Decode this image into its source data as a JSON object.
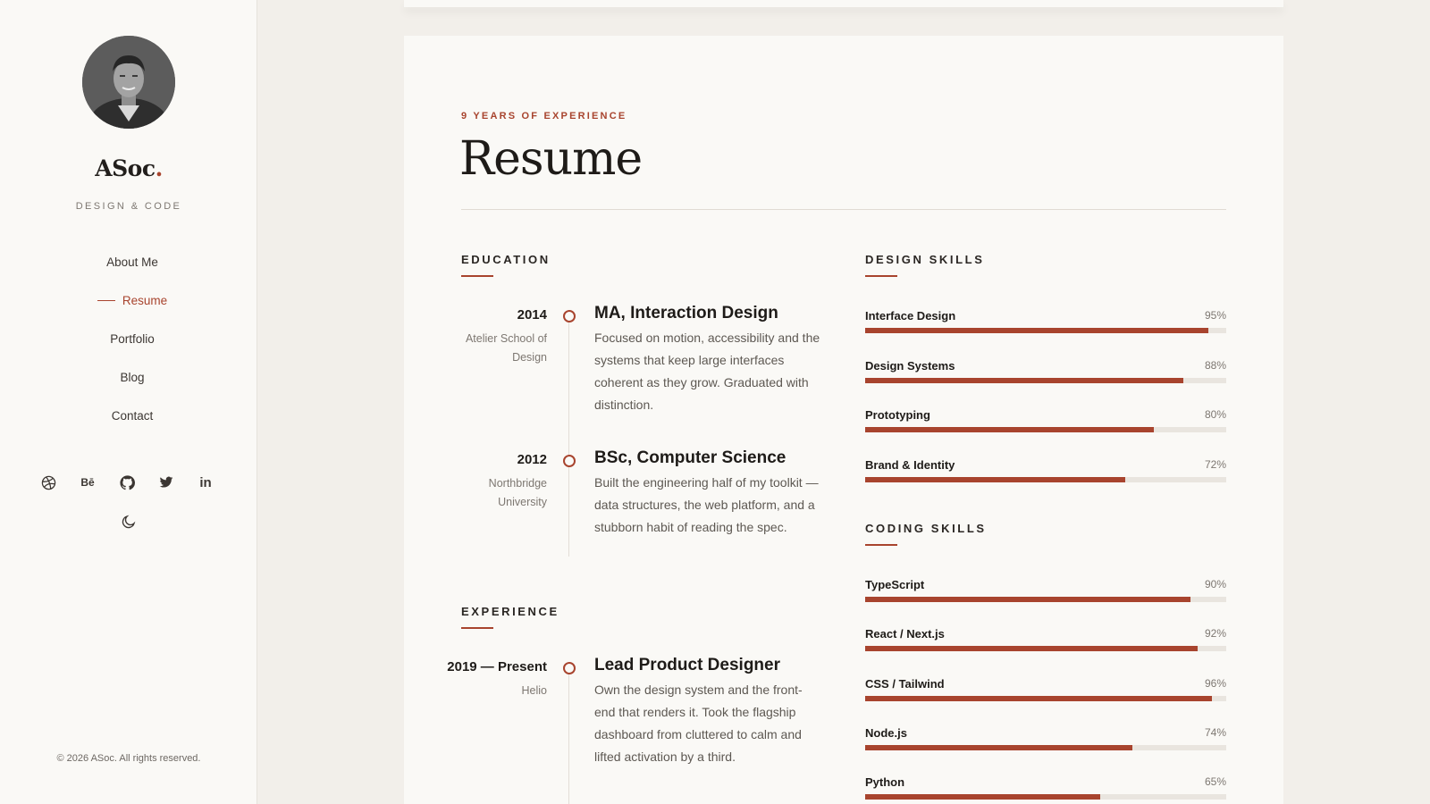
{
  "sidebar": {
    "brand_name": "ASoc",
    "brand_dot": ".",
    "tagline": "DESIGN & CODE",
    "nav": [
      {
        "label": "About Me",
        "active": false
      },
      {
        "label": "Resume",
        "active": true
      },
      {
        "label": "Portfolio",
        "active": false
      },
      {
        "label": "Blog",
        "active": false
      },
      {
        "label": "Contact",
        "active": false
      }
    ],
    "social_icons": [
      "dribbble-icon",
      "behance-icon",
      "github-icon",
      "twitter-icon",
      "linkedin-icon"
    ],
    "behance_label": "Bē",
    "linkedin_label": "in",
    "theme_toggle_icon": "moon-icon",
    "copyright": "© 2026 ASoc. All rights reserved."
  },
  "main": {
    "eyebrow": "9 YEARS OF EXPERIENCE",
    "title": "Resume",
    "education": {
      "heading": "EDUCATION",
      "entries": [
        {
          "year": "2014",
          "org": "Atelier School of Design",
          "role": "MA, Interaction Design",
          "desc": "Focused on motion, accessibility and the systems that keep large interfaces coherent as they grow. Graduated with distinction."
        },
        {
          "year": "2012",
          "org": "Northbridge University",
          "role": "BSc, Computer Science",
          "desc": "Built the engineering half of my toolkit — data structures, the web platform, and a stubborn habit of reading the spec."
        }
      ]
    },
    "experience": {
      "heading": "EXPERIENCE",
      "entries": [
        {
          "year": "2019 — Present",
          "org": "Helio",
          "role": "Lead Product Designer",
          "desc": "Own the design system and the front-end that renders it. Took the flagship dashboard from cluttered to calm and lifted activation by a third."
        }
      ]
    },
    "design_skills": {
      "heading": "DESIGN SKILLS",
      "items": [
        {
          "name": "Interface Design",
          "percent": 95,
          "label": "95%"
        },
        {
          "name": "Design Systems",
          "percent": 88,
          "label": "88%"
        },
        {
          "name": "Prototyping",
          "percent": 80,
          "label": "80%"
        },
        {
          "name": "Brand & Identity",
          "percent": 72,
          "label": "72%"
        }
      ]
    },
    "coding_skills": {
      "heading": "CODING SKILLS",
      "items": [
        {
          "name": "TypeScript",
          "percent": 90,
          "label": "90%"
        },
        {
          "name": "React / Next.js",
          "percent": 92,
          "label": "92%"
        },
        {
          "name": "CSS / Tailwind",
          "percent": 96,
          "label": "96%"
        },
        {
          "name": "Node.js",
          "percent": 74,
          "label": "74%"
        },
        {
          "name": "Python",
          "percent": 65,
          "label": "65%"
        }
      ]
    }
  },
  "colors": {
    "accent": "#a8442e",
    "page_bg": "#f2efea",
    "card_bg": "#faf9f6"
  }
}
